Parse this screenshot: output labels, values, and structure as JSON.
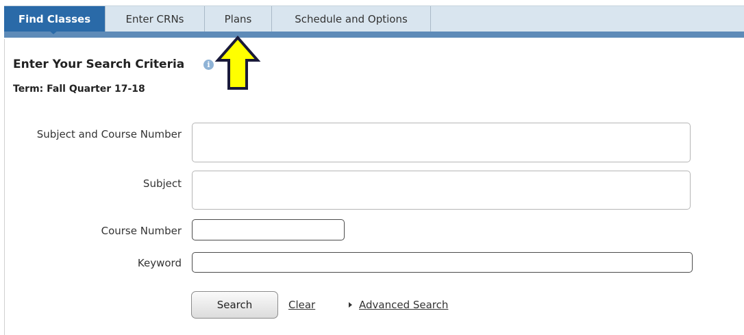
{
  "tabs": [
    {
      "label": "Find Classes",
      "active": true
    },
    {
      "label": "Enter CRNs",
      "active": false
    },
    {
      "label": "Plans",
      "active": false
    },
    {
      "label": "Schedule and Options",
      "active": false
    }
  ],
  "search": {
    "heading": "Enter Your Search Criteria",
    "info_icon": "info-icon",
    "term": "Term: Fall Quarter 17-18"
  },
  "form": {
    "subject_course_label": "Subject and Course Number",
    "subject_course_value": "",
    "subject_label": "Subject",
    "subject_value": "",
    "course_number_label": "Course Number",
    "course_number_value": "",
    "keyword_label": "Keyword",
    "keyword_value": ""
  },
  "actions": {
    "search_label": "Search",
    "clear_label": "Clear",
    "advanced_label": "Advanced Search"
  },
  "annotation": {
    "arrow_icon": "yellow-up-arrow-icon",
    "arrow_color": "#ffff00"
  },
  "colors": {
    "active_tab": "#2a6aa8",
    "tabbar": "#d9e5ef",
    "tab_underline": "#5e8bb8"
  }
}
